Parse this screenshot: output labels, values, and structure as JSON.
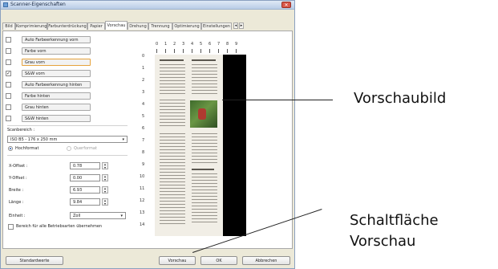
{
  "window": {
    "title": "Scanner-Eigenschaften",
    "close_glyph": "✕"
  },
  "tabs": [
    {
      "label": "Bild",
      "active": false
    },
    {
      "label": "Komprimierung",
      "active": false
    },
    {
      "label": "Farbunterdrückung",
      "active": false
    },
    {
      "label": "Papier",
      "active": false
    },
    {
      "label": "Vorschau",
      "active": true
    },
    {
      "label": "Drehung",
      "active": false
    },
    {
      "label": "Trennung",
      "active": false
    },
    {
      "label": "Optimierung",
      "active": false
    },
    {
      "label": "Einstellungen",
      "active": false
    }
  ],
  "tab_scroll": {
    "left": "◂",
    "right": "▸"
  },
  "image_options": [
    {
      "label": "Auto Farbeerkennung vorn",
      "checked": false
    },
    {
      "label": "Farbe vorn",
      "checked": false
    },
    {
      "label": "Grau vorn",
      "checked": false,
      "focused": true
    },
    {
      "label": "S&W vorn",
      "checked": true
    },
    {
      "label": "Auto Farbeerkennung hinten",
      "checked": false
    },
    {
      "label": "Farbe hinten",
      "checked": false
    },
    {
      "label": "Grau hinten",
      "checked": false
    },
    {
      "label": "S&W hinten",
      "checked": false
    }
  ],
  "check_glyph": "✓",
  "scan_area": {
    "label": "Scanbereich :",
    "value": "ISO B5 - 176 x 250 mm",
    "arrow": "▾"
  },
  "orientation": {
    "portrait": "Hochformat",
    "landscape": "Querformat",
    "selected": "portrait"
  },
  "fields": [
    {
      "label": "X-Offset :",
      "value": "0.78"
    },
    {
      "label": "Y-Offset :",
      "value": "0.00"
    },
    {
      "label": "Breite :",
      "value": "6.93"
    },
    {
      "label": "Länge :",
      "value": "9.84"
    }
  ],
  "spin_glyphs": {
    "up": "▴",
    "down": "▾"
  },
  "unit": {
    "label": "Einheit :",
    "value": "Zoll",
    "arrow": "▾"
  },
  "apply_all": {
    "label": "Bereich für alle Betriebsarten übernehmen",
    "checked": false
  },
  "ruler": {
    "horizontal": [
      "0",
      "1",
      "2",
      "3",
      "4",
      "5",
      "6",
      "7",
      "8",
      "9"
    ],
    "vertical": [
      "0",
      "1",
      "2",
      "3",
      "4",
      "5",
      "6",
      "7",
      "8",
      "9",
      "10",
      "11",
      "12",
      "13",
      "14"
    ]
  },
  "buttons": {
    "defaults": "Standardwerte",
    "preview": "Vorschau",
    "ok": "OK",
    "cancel": "Abbrechen"
  },
  "callouts": {
    "preview_image": "Vorschaubild",
    "preview_button_line1": "Schaltfläche",
    "preview_button_line2": "Vorschau"
  }
}
